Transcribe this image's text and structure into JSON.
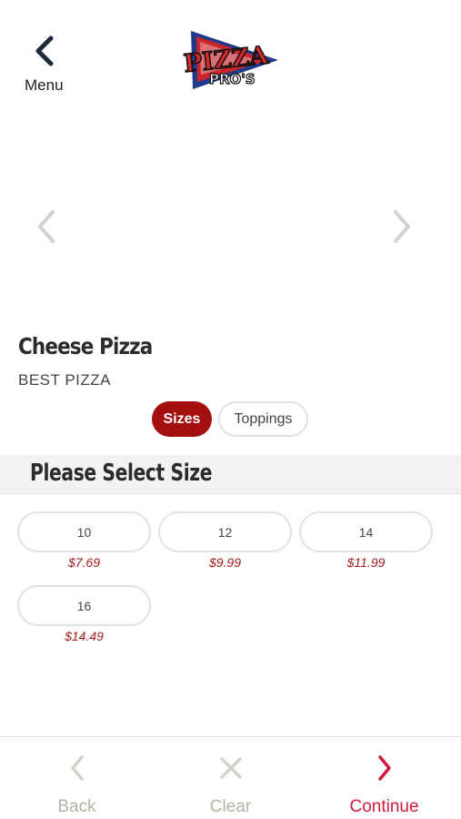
{
  "header": {
    "back_label": "Menu",
    "logo_text_top": "PIZZA",
    "logo_text_bottom": "PRO'S"
  },
  "product": {
    "title": "Cheese Pizza",
    "subtitle": "BEST PIZZA"
  },
  "tabs": [
    {
      "label": "Sizes",
      "active": true
    },
    {
      "label": "Toppings",
      "active": false
    }
  ],
  "section": {
    "title": "Please Select Size"
  },
  "sizes": [
    {
      "size": "10",
      "price": "$7.69"
    },
    {
      "size": "12",
      "price": "$9.99"
    },
    {
      "size": "14",
      "price": "$11.99"
    },
    {
      "size": "16",
      "price": "$14.49"
    }
  ],
  "footer": {
    "back_label": "Back",
    "clear_label": "Clear",
    "continue_label": "Continue"
  },
  "colors": {
    "accent": "#a30f0f",
    "price": "#a31d1d",
    "continue": "#d01c3c",
    "muted": "#b7b2a6"
  },
  "icons": {
    "back": "chevron-left-icon",
    "carousel_prev": "chevron-left-icon",
    "carousel_next": "chevron-right-icon",
    "clear": "close-icon",
    "continue": "chevron-right-icon"
  }
}
